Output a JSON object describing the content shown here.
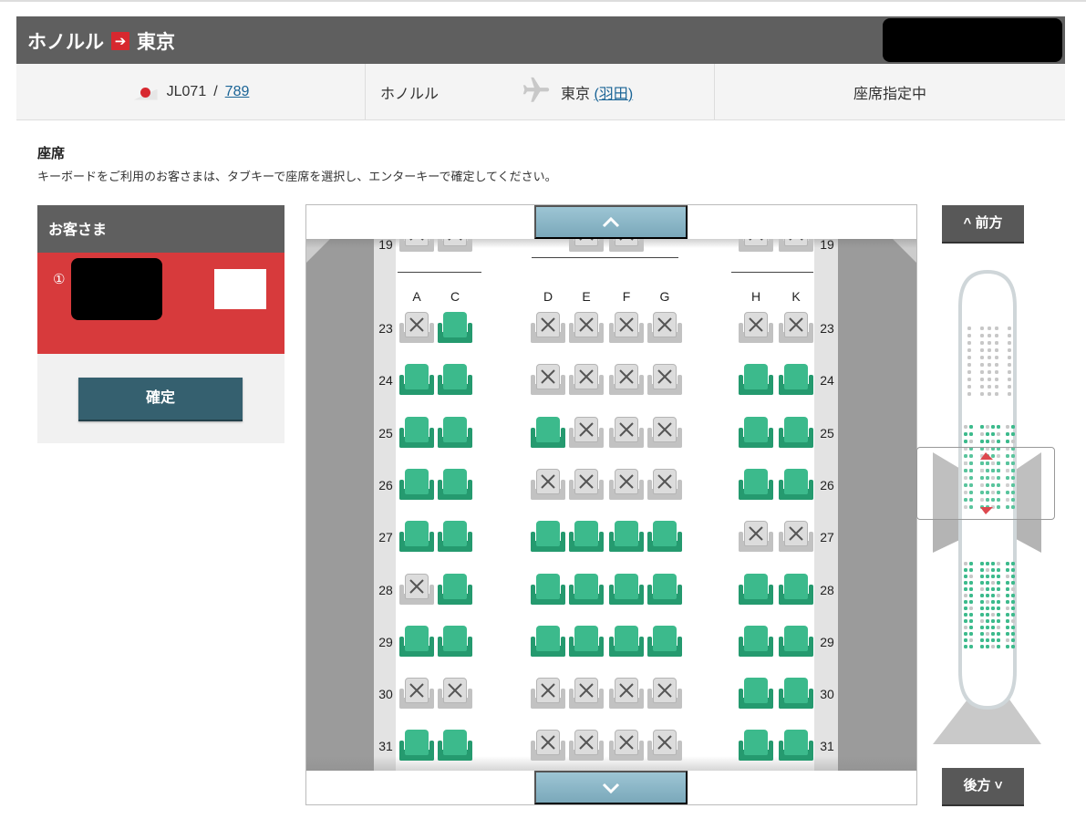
{
  "header": {
    "origin": "ホノルル",
    "arrow": "➔",
    "destination": "東京"
  },
  "flight_info": {
    "flight_number": "JL071",
    "separator": "/",
    "aircraft_code": "789",
    "origin": "ホノルル",
    "destination_city": "東京",
    "destination_paren_open": "(",
    "destination_airport": "羽田",
    "destination_paren_close": ")",
    "status": "座席指定中"
  },
  "seat_section": {
    "title": "座席",
    "instruction": "キーボードをご利用のお客さまは、タブキーで座席を選択し、エンターキーで確定してください。"
  },
  "passenger_panel": {
    "title": "お客さま",
    "passenger_number": "①",
    "confirm_label": "確定"
  },
  "seat_map": {
    "partial_row": "19",
    "columns": [
      "A",
      "C",
      "D",
      "E",
      "F",
      "G",
      "H",
      "K"
    ],
    "rows": [
      {
        "num": "23",
        "seats": [
          "occupied",
          "available",
          "occupied",
          "occupied",
          "occupied",
          "occupied",
          "occupied",
          "occupied"
        ]
      },
      {
        "num": "24",
        "seats": [
          "available",
          "available",
          "occupied",
          "occupied",
          "occupied",
          "occupied",
          "available",
          "available"
        ]
      },
      {
        "num": "25",
        "seats": [
          "available",
          "available",
          "available",
          "occupied",
          "occupied",
          "occupied",
          "available",
          "available"
        ]
      },
      {
        "num": "26",
        "seats": [
          "available",
          "available",
          "occupied",
          "occupied",
          "occupied",
          "occupied",
          "available",
          "available"
        ]
      },
      {
        "num": "27",
        "seats": [
          "available",
          "available",
          "available",
          "available",
          "available",
          "available",
          "occupied",
          "occupied"
        ]
      },
      {
        "num": "28",
        "seats": [
          "occupied",
          "available",
          "available",
          "available",
          "available",
          "available",
          "available",
          "available"
        ]
      },
      {
        "num": "29",
        "seats": [
          "available",
          "available",
          "available",
          "available",
          "available",
          "available",
          "available",
          "available"
        ]
      },
      {
        "num": "30",
        "seats": [
          "occupied",
          "occupied",
          "occupied",
          "occupied",
          "occupied",
          "occupied",
          "available",
          "available"
        ]
      },
      {
        "num": "31",
        "seats": [
          "available",
          "available",
          "occupied",
          "occupied",
          "occupied",
          "occupied",
          "available",
          "available"
        ]
      }
    ],
    "scroll_up_icon": "chevron-up-icon",
    "scroll_down_icon": "chevron-down-icon"
  },
  "mini_map": {
    "front_label": "前方",
    "rear_label": "後方"
  },
  "colors": {
    "header_bg": "#5f5f5f",
    "accent_red": "#d7282f",
    "seat_available": "#3cba8c",
    "seat_occupied": "#dcdcdc",
    "confirm_button": "#35606f",
    "scroll_button": "#8fb9c9"
  }
}
